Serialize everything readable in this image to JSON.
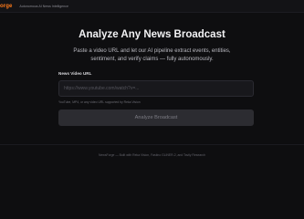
{
  "header": {
    "brand": "orge",
    "tagline": "Autonomous AI News Intelligence"
  },
  "hero": {
    "headline": "Analyze Any News Broadcast",
    "subtitle": "Paste a video URL and let our AI pipeline extract events, entities, sentiment, and verify claims — fully autonomously."
  },
  "form": {
    "url_label": "News Video URL",
    "url_value": "",
    "url_placeholder": "https://www.youtube.com/watch?v=...",
    "hint": "YouTube, MP4, or any video URL supported by Reka Vision",
    "submit_label": "Analyze Broadcast"
  },
  "footer": {
    "text": "NewsForge — Built with Reka Vision, Fastino GLiNER-2, and Tavily Research"
  },
  "colors": {
    "background": "#0e0e10",
    "brand_accent": "#ff7a1a",
    "button_disabled": "#2c2c31"
  }
}
